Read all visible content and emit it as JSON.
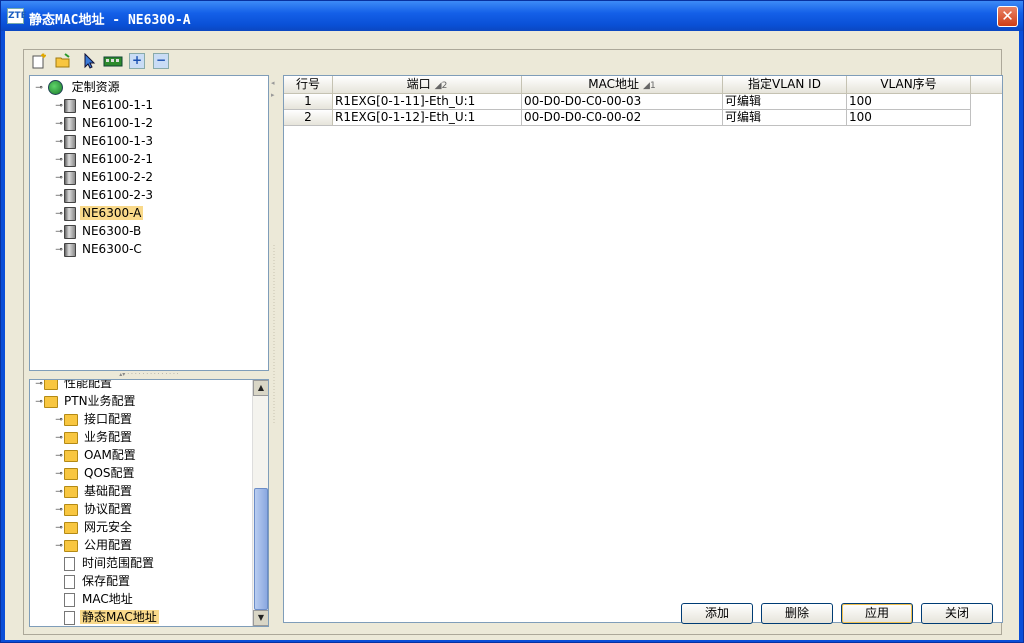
{
  "window": {
    "title": "静态MAC地址 - NE6300-A",
    "app_icon_text": "ZTE",
    "close_glyph": "✕"
  },
  "toolbar": {
    "icons": [
      "new-icon",
      "open-icon",
      "select-icon",
      "board-icon",
      "expand-icon",
      "collapse-icon"
    ]
  },
  "ne_tree": {
    "root": "定制资源",
    "items": [
      "NE6100-1-1",
      "NE6100-1-2",
      "NE6100-1-3",
      "NE6100-2-1",
      "NE6100-2-2",
      "NE6100-2-3",
      "NE6300-A",
      "NE6300-B",
      "NE6300-C"
    ],
    "selected": "NE6300-A"
  },
  "func_tree": {
    "items": [
      {
        "label": "性能配置",
        "level": 0,
        "type": "folder"
      },
      {
        "label": "PTN业务配置",
        "level": 0,
        "type": "folder"
      },
      {
        "label": "接口配置",
        "level": 1,
        "type": "folder"
      },
      {
        "label": "业务配置",
        "level": 1,
        "type": "folder"
      },
      {
        "label": "OAM配置",
        "level": 1,
        "type": "folder"
      },
      {
        "label": "QOS配置",
        "level": 1,
        "type": "folder"
      },
      {
        "label": "基础配置",
        "level": 1,
        "type": "folder"
      },
      {
        "label": "协议配置",
        "level": 1,
        "type": "folder"
      },
      {
        "label": "网元安全",
        "level": 1,
        "type": "folder"
      },
      {
        "label": "公用配置",
        "level": 1,
        "type": "folder"
      },
      {
        "label": "时间范围配置",
        "level": 1,
        "type": "doc"
      },
      {
        "label": "保存配置",
        "level": 1,
        "type": "doc"
      },
      {
        "label": "MAC地址",
        "level": 1,
        "type": "doc"
      },
      {
        "label": "静态MAC地址",
        "level": 1,
        "type": "doc"
      }
    ],
    "selected": "静态MAC地址"
  },
  "table": {
    "columns": [
      {
        "label": "行号",
        "sort": ""
      },
      {
        "label": "端口",
        "sort": "2"
      },
      {
        "label": "MAC地址",
        "sort": "1"
      },
      {
        "label": "指定VLAN ID",
        "sort": ""
      },
      {
        "label": "VLAN序号",
        "sort": ""
      }
    ],
    "rows": [
      [
        "1",
        "R1EXG[0-1-11]-Eth_U:1",
        "00-D0-D0-C0-00-03",
        "可编辑",
        "100"
      ],
      [
        "2",
        "R1EXG[0-1-12]-Eth_U:1",
        "00-D0-D0-C0-00-02",
        "可编辑",
        "100"
      ]
    ]
  },
  "buttons": {
    "add": "添加",
    "delete": "删除",
    "apply": "应用",
    "close": "关闭"
  },
  "colors": {
    "title_bar": "#0a50d6",
    "selection": "#f9d98a",
    "panel_bg": "#ece9d8"
  }
}
